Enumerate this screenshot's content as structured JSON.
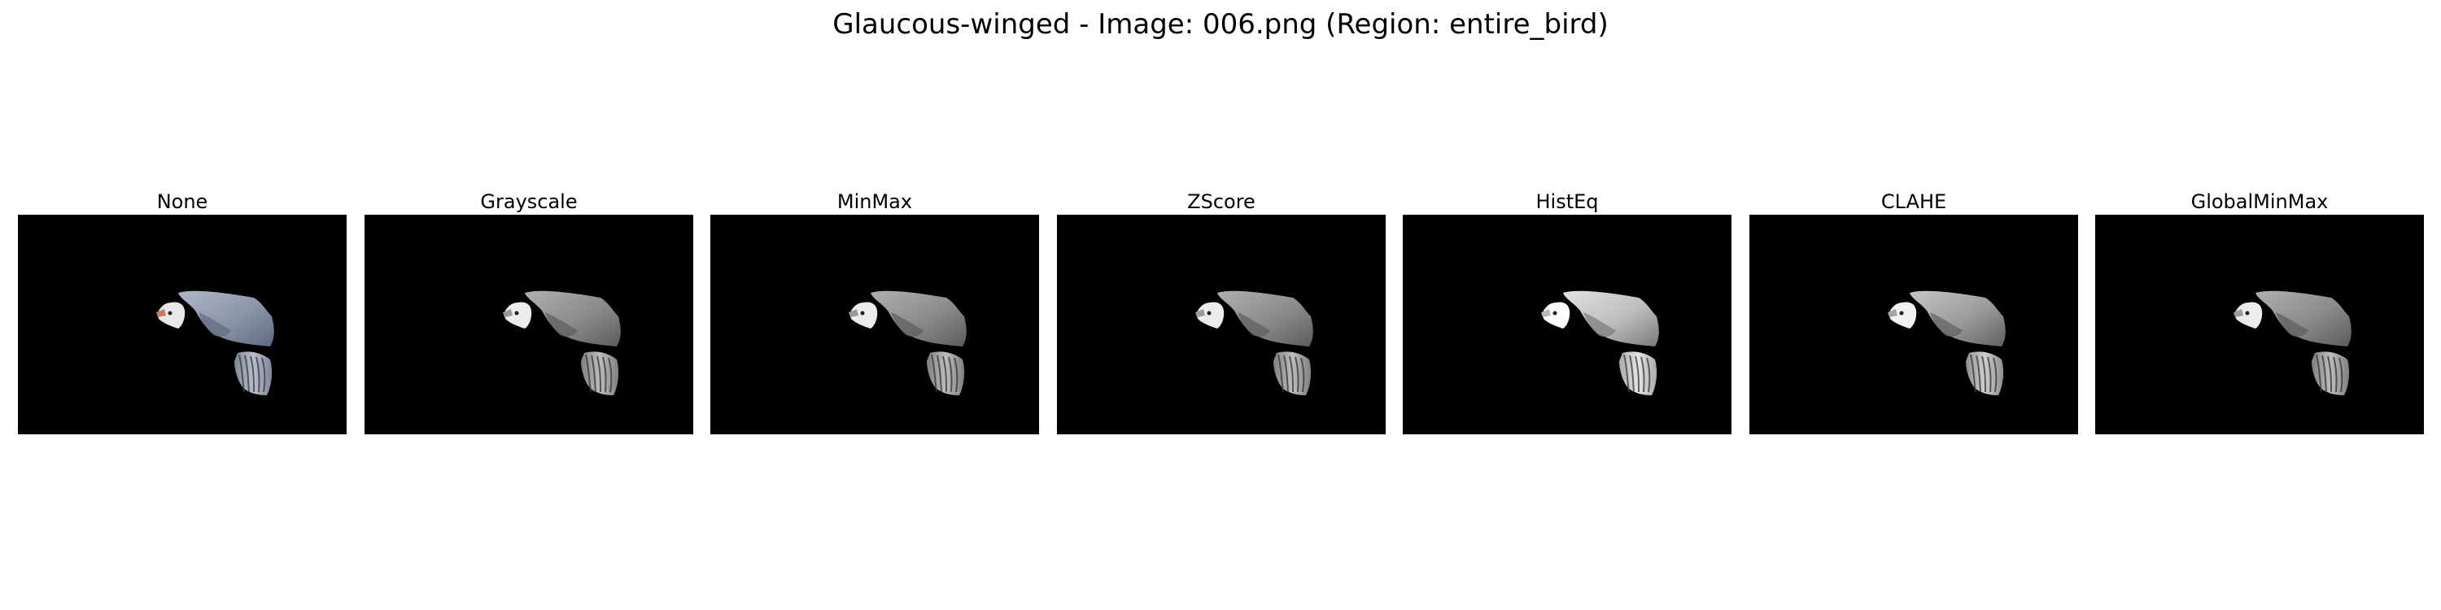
{
  "figure": {
    "title": "Glaucous-winged - Image: 006.png (Region: entire_bird)"
  },
  "panels": [
    {
      "label": "None",
      "style": "color"
    },
    {
      "label": "Grayscale",
      "style": "gray"
    },
    {
      "label": "MinMax",
      "style": "gray"
    },
    {
      "label": "ZScore",
      "style": "gray"
    },
    {
      "label": "HistEq",
      "style": "histeq"
    },
    {
      "label": "CLAHE",
      "style": "clahe"
    },
    {
      "label": "GlobalMinMax",
      "style": "gray"
    }
  ],
  "colors": {
    "background": "#ffffff",
    "image_background": "#000000"
  }
}
